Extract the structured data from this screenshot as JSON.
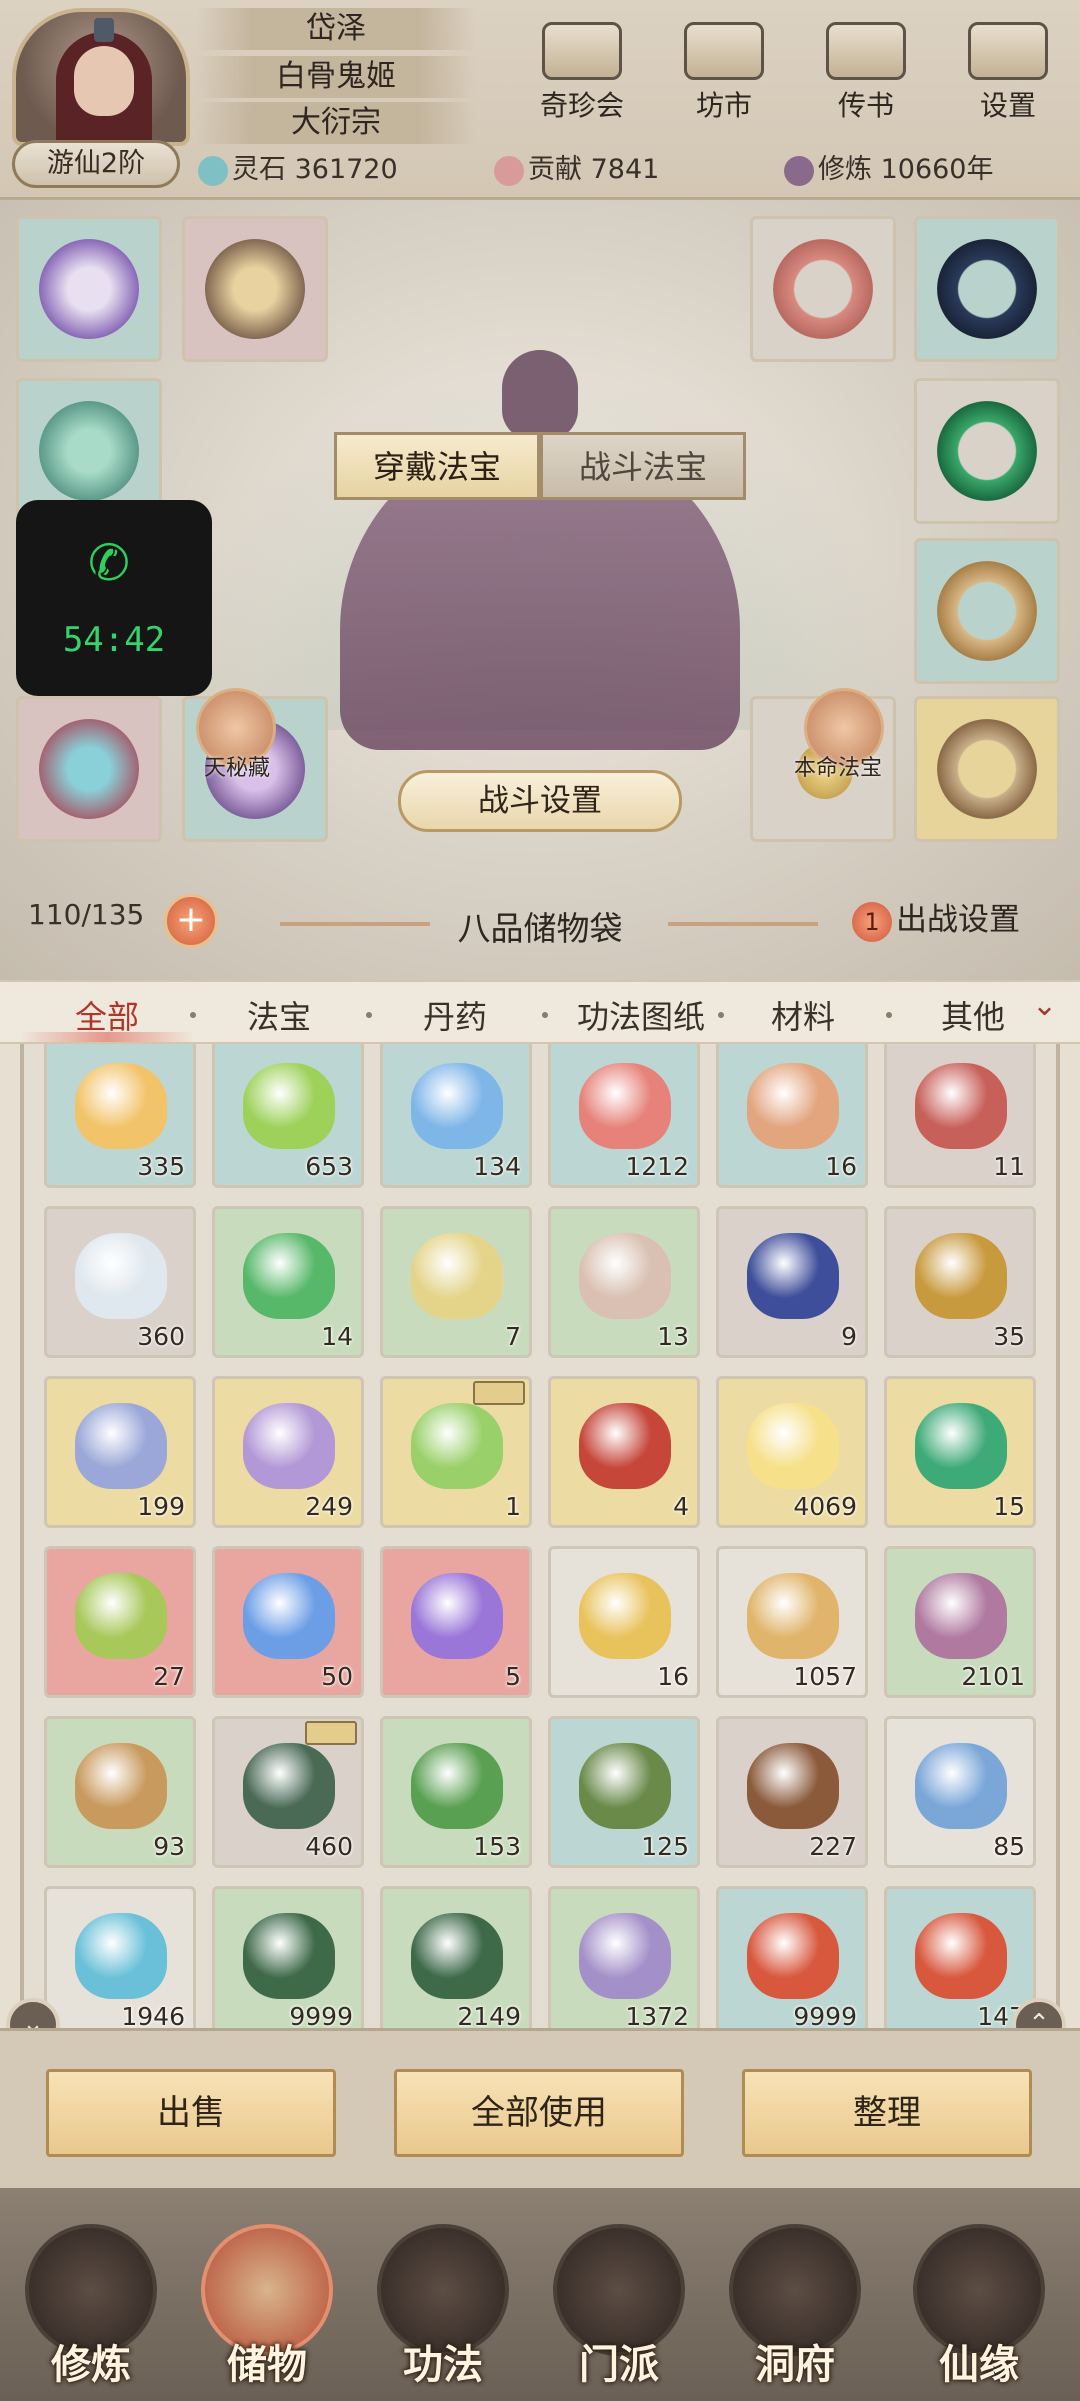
{
  "player": {
    "name": "岱泽",
    "title": "白骨鬼姬",
    "sect": "大衍宗",
    "rank": "游仙2阶"
  },
  "top_menu": [
    {
      "label": "奇珍会",
      "icon": "treasure-pavilion-icon"
    },
    {
      "label": "坊市",
      "icon": "market-icon"
    },
    {
      "label": "传书",
      "icon": "letter-icon"
    },
    {
      "label": "设置",
      "icon": "gear-icon"
    }
  ],
  "resources": {
    "spirit_stone": "灵石 361720",
    "contribution": "贡献 7841",
    "cultivation": "修炼 10660年"
  },
  "equip_tabs": {
    "worn": "穿戴法宝",
    "battle": "战斗法宝"
  },
  "equip_labels": {
    "left": "天秘藏",
    "right": "本命法宝"
  },
  "battle_settings": "战斗设置",
  "call": {
    "time": "54:42"
  },
  "bag": {
    "capacity": "110/135",
    "title": "八品储物袋",
    "deploy_count": "1",
    "deploy_label": "出战设置"
  },
  "categories": [
    "全部",
    "法宝",
    "丹药",
    "功法图纸",
    "材料",
    "其他"
  ],
  "inventory": [
    {
      "qty": "335",
      "bg": "blue",
      "color": "#f2c46a"
    },
    {
      "qty": "653",
      "bg": "blue",
      "color": "#9ed15a"
    },
    {
      "qty": "134",
      "bg": "blue",
      "color": "#7fb6e8"
    },
    {
      "qty": "1212",
      "bg": "blue",
      "color": "#e6827a"
    },
    {
      "qty": "16",
      "bg": "blue",
      "color": "#e2a57e"
    },
    {
      "qty": "11",
      "bg": "grey",
      "color": "#c8605a"
    },
    {
      "qty": "360",
      "bg": "grey",
      "color": "#dfe8ee"
    },
    {
      "qty": "14",
      "bg": "green",
      "color": "#58b86a"
    },
    {
      "qty": "7",
      "bg": "green",
      "color": "#e4d48a"
    },
    {
      "qty": "13",
      "bg": "green",
      "color": "#d9c0b2"
    },
    {
      "qty": "9",
      "bg": "grey",
      "color": "#3e4e9a"
    },
    {
      "qty": "35",
      "bg": "grey",
      "color": "#c89a3e"
    },
    {
      "qty": "199",
      "bg": "gold",
      "color": "#9aa7d8"
    },
    {
      "qty": "249",
      "bg": "gold",
      "color": "#b298d6"
    },
    {
      "qty": "1",
      "bg": "gold",
      "color": "#9ad06a",
      "tag": true
    },
    {
      "qty": "4",
      "bg": "gold",
      "color": "#c6463a"
    },
    {
      "qty": "4069",
      "bg": "gold",
      "color": "#f6e08a"
    },
    {
      "qty": "15",
      "bg": "gold",
      "color": "#3eaa78"
    },
    {
      "qty": "27",
      "bg": "red",
      "color": "#a8c85a"
    },
    {
      "qty": "50",
      "bg": "red",
      "color": "#6c9ee6"
    },
    {
      "qty": "5",
      "bg": "red",
      "color": "#9a76d8"
    },
    {
      "qty": "16",
      "bg": "white",
      "color": "#e8c25a"
    },
    {
      "qty": "1057",
      "bg": "white",
      "color": "#e0b46a"
    },
    {
      "qty": "2101",
      "bg": "green",
      "color": "#b07aa0"
    },
    {
      "qty": "93",
      "bg": "green",
      "color": "#c89a5e"
    },
    {
      "qty": "460",
      "bg": "grey",
      "color": "#4a6a56",
      "tag": true
    },
    {
      "qty": "153",
      "bg": "green",
      "color": "#5aa052"
    },
    {
      "qty": "125",
      "bg": "blue",
      "color": "#6a8a4a"
    },
    {
      "qty": "227",
      "bg": "grey",
      "color": "#8a5a3a"
    },
    {
      "qty": "85",
      "bg": "white",
      "color": "#7aa6d8"
    },
    {
      "qty": "1946",
      "bg": "white",
      "color": "#6ac0d8"
    },
    {
      "qty": "9999",
      "bg": "green",
      "color": "#3e6a4a"
    },
    {
      "qty": "2149",
      "bg": "green",
      "color": "#3e6a4a"
    },
    {
      "qty": "1372",
      "bg": "green",
      "color": "#a490c8"
    },
    {
      "qty": "9999",
      "bg": "blue",
      "color": "#d8583e"
    },
    {
      "qty": "147",
      "bg": "blue",
      "color": "#d8583e"
    }
  ],
  "actions": {
    "sell": "出售",
    "use_all": "全部使用",
    "organize": "整理"
  },
  "nav": [
    "修炼",
    "储物",
    "功法",
    "门派",
    "洞府",
    "仙缘"
  ]
}
